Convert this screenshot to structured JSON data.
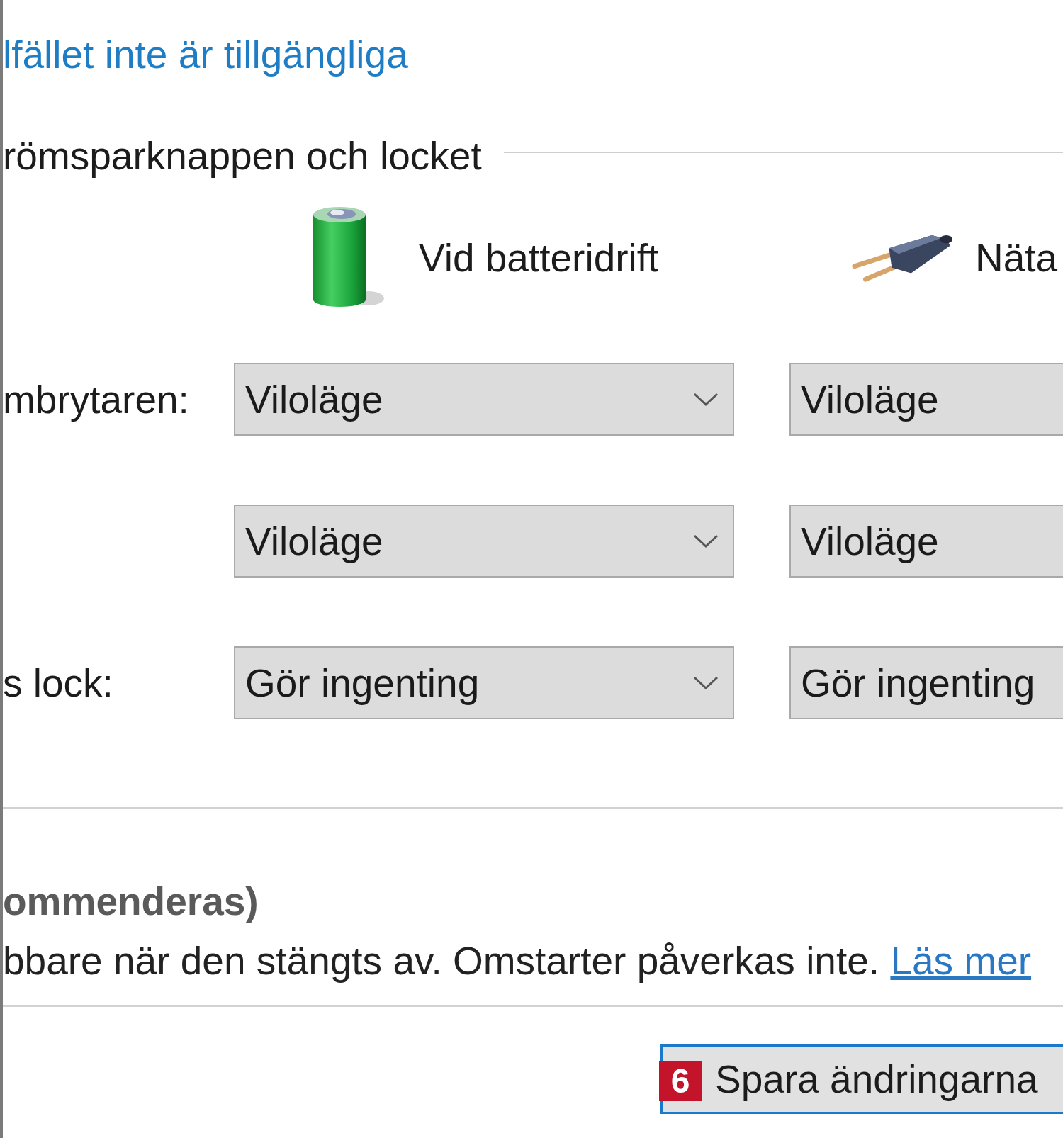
{
  "link": {
    "text": "lfället inte är tillgängliga"
  },
  "section": {
    "title": "römsparknappen och locket"
  },
  "columns": [
    {
      "kind": "battery",
      "label": "Vid batteridrift"
    },
    {
      "kind": "plug",
      "label": "Näta"
    }
  ],
  "settings": [
    {
      "label": "mbrytaren:",
      "values": [
        "Viloläge",
        "Viloläge"
      ]
    },
    {
      "values": [
        "Viloläge",
        "Viloläge"
      ]
    },
    {
      "label": "s lock:",
      "values": [
        "Gör ingenting",
        "Gör ingenting"
      ]
    }
  ],
  "shutdown_option": {
    "title": "ommenderas)",
    "description": "bbare när den stängts av. Omstarter påverkas inte.",
    "link": "Läs mer"
  },
  "save_button": {
    "label": "Spara ändringarna",
    "badge": "6"
  }
}
